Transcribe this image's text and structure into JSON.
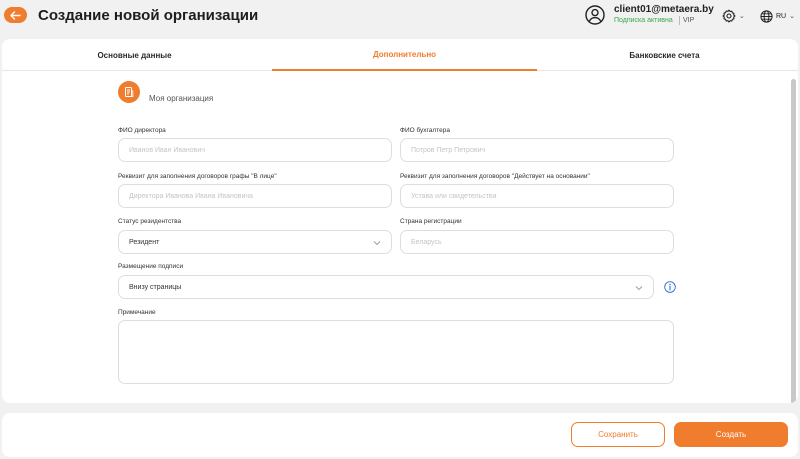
{
  "header": {
    "title": "Создание новой организации",
    "back_icon": "arrow-left-icon",
    "user_email": "client01@metaera.by",
    "subscription_status": "Подписка активна",
    "subscription_plan": "VIP",
    "language": "RU"
  },
  "tabs": [
    {
      "label": "Основные данные",
      "active": false
    },
    {
      "label": "Дополнительно",
      "active": true
    },
    {
      "label": "Банковские счета",
      "active": false
    }
  ],
  "organization": {
    "name": "Моя организация",
    "icon": "building-document-icon"
  },
  "form": {
    "director": {
      "label": "ФИО директора",
      "placeholder": "Иванов Иван Иванович"
    },
    "accountant": {
      "label": "ФИО бухгалтера",
      "placeholder": "Потров Петр Петрович"
    },
    "in_person": {
      "label": "Реквизит для заполнения договоров графы \"В лице\"",
      "placeholder": "Директора Иванова Ивана Ивановича"
    },
    "acting_basis": {
      "label": "Реквизит для заполнения договоров \"Действует на основании\"",
      "placeholder": "Устава или свидетельства"
    },
    "residency": {
      "label": "Статус резидентства",
      "value": "Резидент"
    },
    "country": {
      "label": "Страна регистрации",
      "placeholder": "Беларусь"
    },
    "signature": {
      "label": "Размещение подписи",
      "value": "Внизу страницы"
    },
    "note": {
      "label": "Примечание",
      "value": ""
    }
  },
  "footer": {
    "save_label": "Сохранить",
    "create_label": "Создать"
  },
  "colors": {
    "accent": "#f07c2e",
    "success": "#3aa64a",
    "info": "#2f6fd6"
  }
}
